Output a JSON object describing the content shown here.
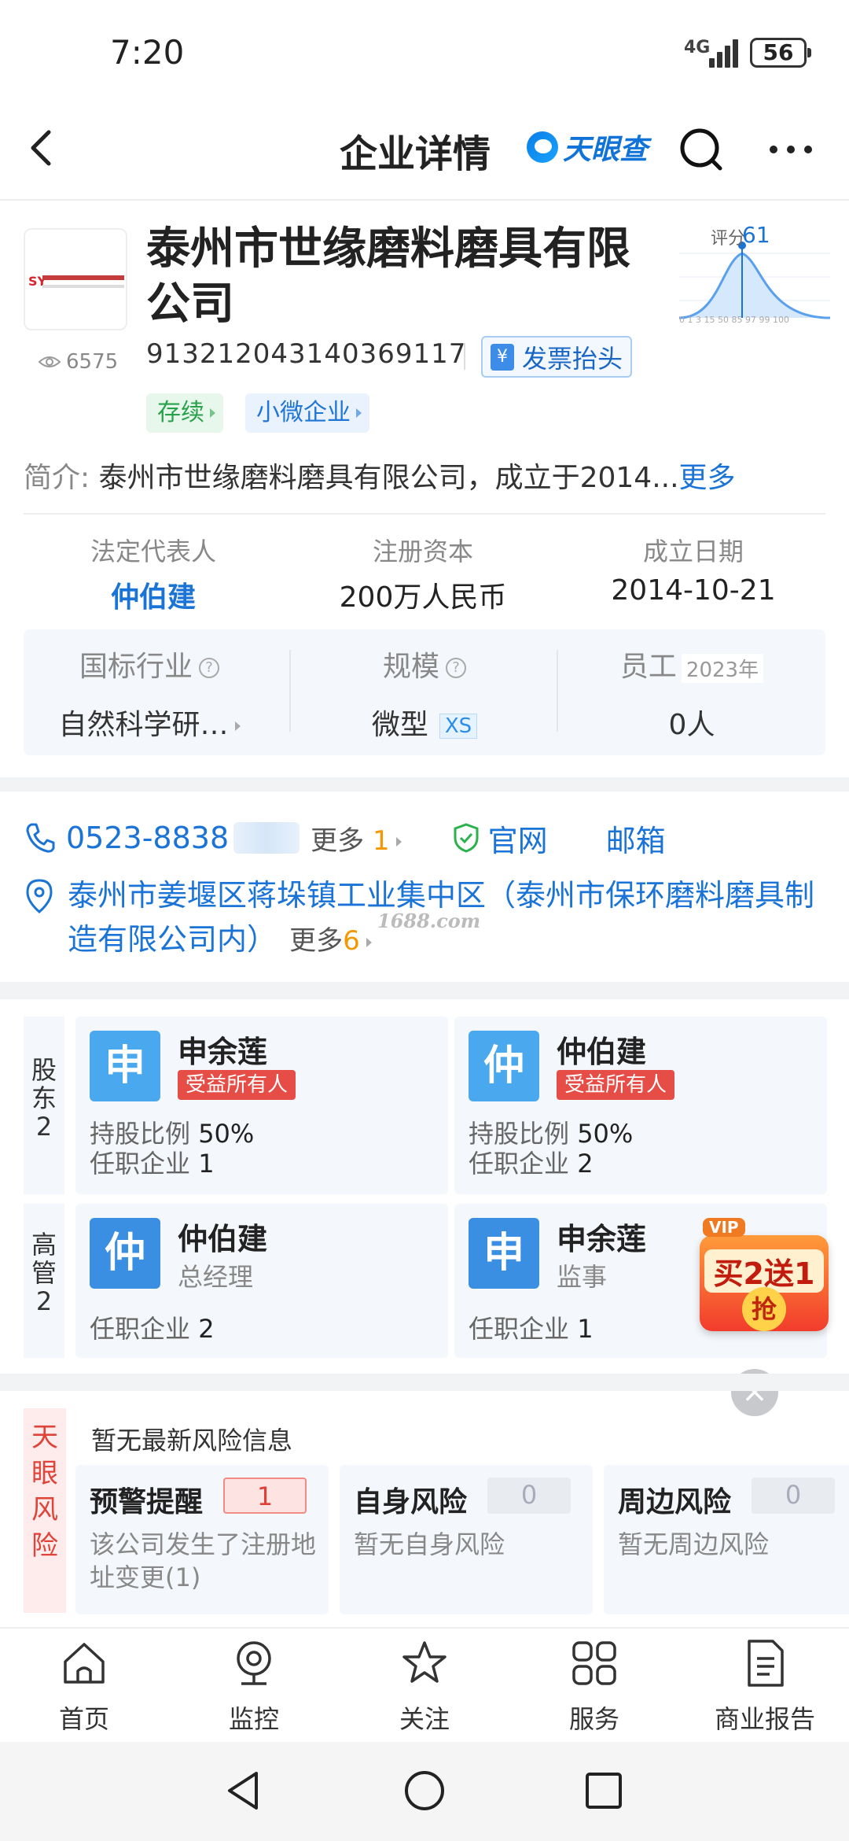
{
  "status_bar": {
    "time": "7:20",
    "network": "4G",
    "battery": "56"
  },
  "header": {
    "title": "企业详情",
    "brand": "天眼查"
  },
  "company": {
    "name": "泰州市世缘磨料磨具有限公司",
    "views": "6575",
    "score_label": "评分",
    "score": "61",
    "credit_code": "913212043140369117",
    "invoice_button": "发票抬头",
    "tags": [
      "存续",
      "小微企业"
    ],
    "intro_label": "简介:",
    "intro_text": "泰州市世缘磨料磨具有限公司，成立于2014...",
    "intro_more": "更多"
  },
  "basic_info": {
    "legal_rep_label": "法定代表人",
    "legal_rep": "仲伯建",
    "reg_capital_label": "注册资本",
    "reg_capital": "200万人民币",
    "est_date_label": "成立日期",
    "est_date": "2014-10-21",
    "industry_label": "国标行业",
    "industry": "自然科学研…",
    "scale_label": "规模",
    "scale": "微型",
    "scale_badge": "XS",
    "employees_label": "员工",
    "employees_year": "2023年",
    "employees": "0人"
  },
  "contact": {
    "phone": "0523-8838",
    "phone_more": "更多",
    "phone_more_count": "1",
    "website": "官网",
    "email": "邮箱",
    "address": "泰州市姜堰区蒋垛镇工业集中区（泰州市保环磨料磨具制造有限公司内）",
    "address_more": "更多",
    "address_more_count": "6",
    "watermark": "1688.com"
  },
  "shareholders": {
    "side_label": "股东",
    "count": "2",
    "items": [
      {
        "avatar": "申",
        "name": "申余莲",
        "badge": "受益所有人",
        "ratio_label": "持股比例",
        "ratio": "50%",
        "posts_label": "任职企业",
        "posts": "1"
      },
      {
        "avatar": "仲",
        "name": "仲伯建",
        "badge": "受益所有人",
        "ratio_label": "持股比例",
        "ratio": "50%",
        "posts_label": "任职企业",
        "posts": "2"
      }
    ]
  },
  "executives": {
    "side_label": "高管",
    "count": "2",
    "items": [
      {
        "avatar": "仲",
        "name": "仲伯建",
        "role": "总经理",
        "posts_label": "任职企业",
        "posts": "2"
      },
      {
        "avatar": "申",
        "name": "申余莲",
        "role": "监事",
        "posts_label": "任职企业",
        "posts": "1"
      }
    ]
  },
  "promo": {
    "vip": "VIP",
    "text": "买2送1",
    "action": "抢"
  },
  "risk": {
    "side_label": "天眼风险",
    "none_text": "暂无最新风险信息",
    "cards": [
      {
        "title": "预警提醒",
        "count": "1",
        "desc": "该公司发生了注册地址变更(1)"
      },
      {
        "title": "自身风险",
        "count": "0",
        "desc": "暂无自身风险"
      },
      {
        "title": "周边风险",
        "count": "0",
        "desc": "暂无周边风险"
      }
    ]
  },
  "tabbar": [
    {
      "label": "首页",
      "icon": "home-icon"
    },
    {
      "label": "监控",
      "icon": "camera-icon"
    },
    {
      "label": "关注",
      "icon": "star-icon"
    },
    {
      "label": "服务",
      "icon": "grid-icon"
    },
    {
      "label": "商业报告",
      "icon": "report-icon"
    }
  ],
  "colors": {
    "accent": "#1a73d6",
    "warning": "#e03e36",
    "orange": "#f39800"
  }
}
